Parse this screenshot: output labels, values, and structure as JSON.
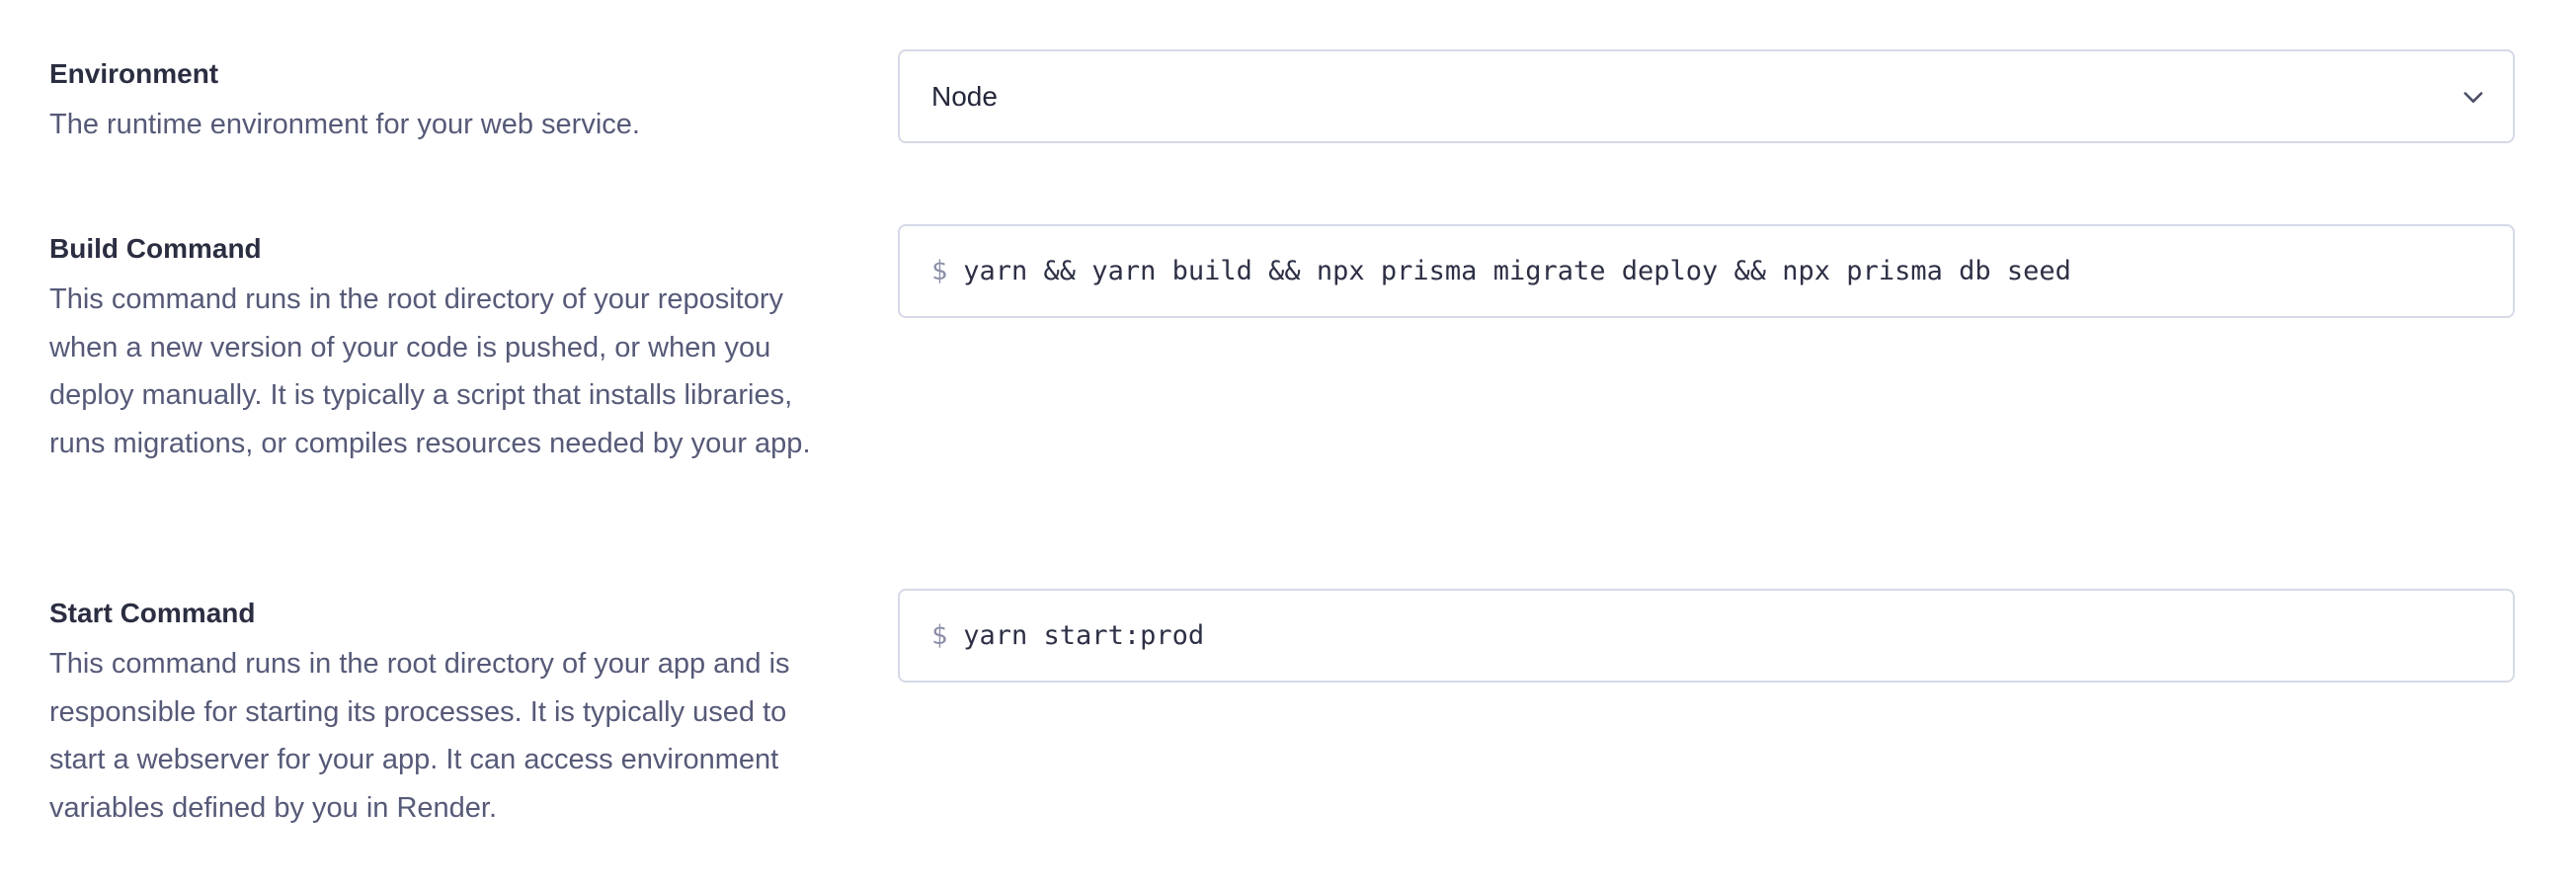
{
  "environment": {
    "title": "Environment",
    "description": "The runtime environment for your web service.",
    "selected": "Node",
    "chevron_icon": "chevron-down-icon"
  },
  "build_command": {
    "title": "Build Command",
    "description": "This command runs in the root directory of your repository when a new version of your code is pushed, or when you deploy manually. It is typically a script that installs libraries, runs migrations, or compiles resources needed by your app.",
    "prompt": "$",
    "value": "yarn && yarn build && npx prisma migrate deploy && npx prisma db seed"
  },
  "start_command": {
    "title": "Start Command",
    "description": "This command runs in the root directory of your app and is responsible for starting its processes. It is typically used to start a webserver for your app. It can access environment variables defined by you in Render.",
    "prompt": "$",
    "value": "yarn start:prod"
  },
  "colors": {
    "border": "#d6d9e6",
    "title_text": "#2b2e41",
    "description_text": "#565a78",
    "prompt_text": "#8a8ea6"
  }
}
